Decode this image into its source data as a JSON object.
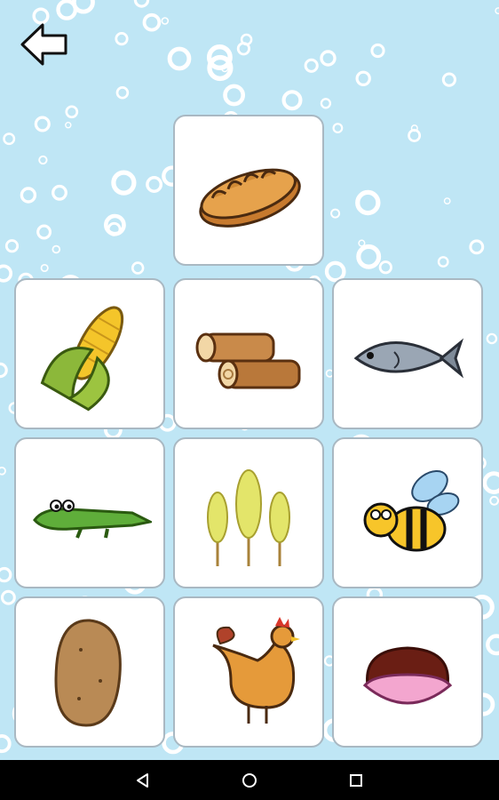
{
  "screen": {
    "background_color": "#bfe6f5",
    "bubble_color": "#ffffff"
  },
  "header": {
    "back_icon": "arrow-left-icon"
  },
  "cards": {
    "target": {
      "item": "bread",
      "icon": "bread-icon"
    },
    "choices": [
      {
        "item": "corn",
        "icon": "corn-icon"
      },
      {
        "item": "logs",
        "icon": "logs-icon"
      },
      {
        "item": "fish",
        "icon": "fish-icon"
      },
      {
        "item": "crocodile",
        "icon": "crocodile-icon"
      },
      {
        "item": "wheat",
        "icon": "wheat-icon"
      },
      {
        "item": "bee",
        "icon": "bee-icon"
      },
      {
        "item": "potato",
        "icon": "potato-icon"
      },
      {
        "item": "hen",
        "icon": "hen-icon"
      },
      {
        "item": "clam shell",
        "icon": "clam-shell-icon"
      }
    ]
  },
  "navbar": {
    "background_color": "#000000",
    "buttons": [
      {
        "icon": "nav-back-icon"
      },
      {
        "icon": "nav-home-icon"
      },
      {
        "icon": "nav-recents-icon"
      }
    ]
  }
}
